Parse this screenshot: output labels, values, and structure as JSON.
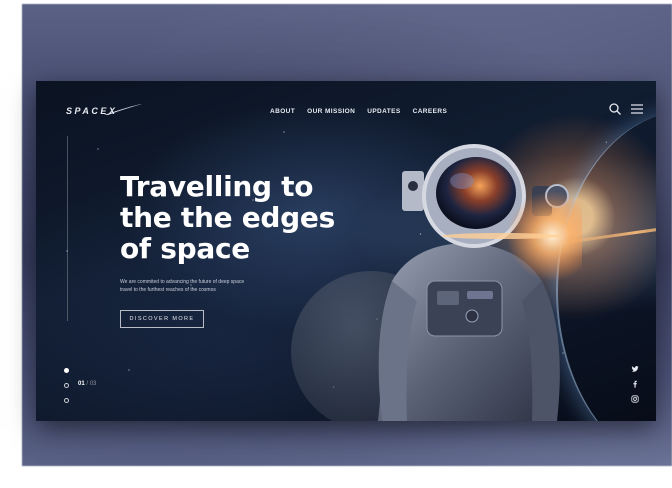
{
  "header": {
    "logo": "SPACEX",
    "nav": [
      {
        "label": "ABOUT"
      },
      {
        "label": "OUR MISSION"
      },
      {
        "label": "UPDATES"
      },
      {
        "label": "CAREERS"
      }
    ],
    "icons": [
      "search-icon",
      "menu-icon"
    ]
  },
  "hero": {
    "headline_line1": "Travelling to",
    "headline_line2": "the the edges",
    "headline_line3": "of space",
    "subtext_line1": "We are commited to advancing the future of deep space",
    "subtext_line2": "travel to the furthest reaches of the cosmos",
    "cta_label": "DISCOVER MORE"
  },
  "slider": {
    "current": "01",
    "separator": "/",
    "total": "03",
    "active_index": 1
  },
  "social": [
    "twitter-icon",
    "facebook-icon",
    "instagram-icon"
  ],
  "colors": {
    "background_dark": "#0b1322",
    "text_primary": "#ffffff",
    "backdrop": "#3c4366",
    "flare": "#ffb070"
  }
}
